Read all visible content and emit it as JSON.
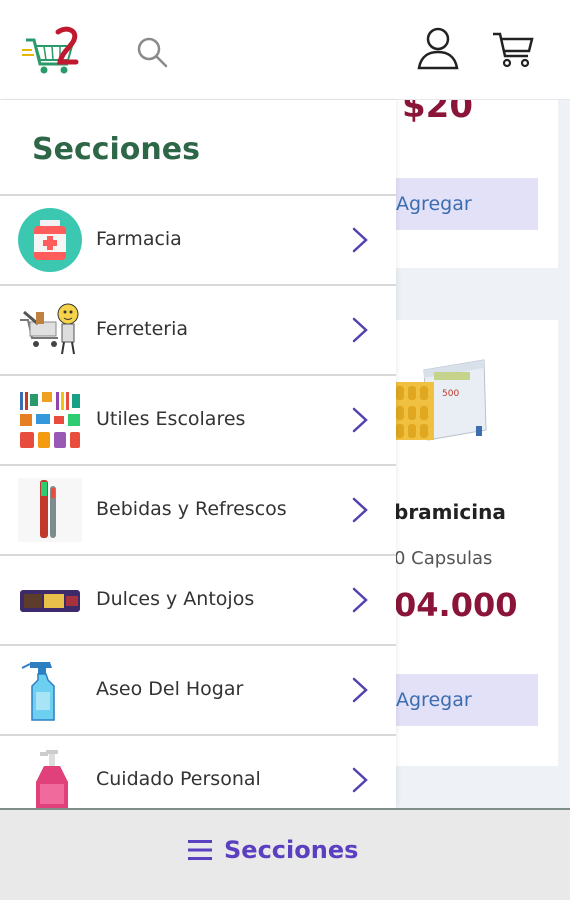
{
  "header": {
    "icons": [
      "logo",
      "search-icon",
      "user-icon",
      "cart-icon"
    ]
  },
  "background_cards": {
    "card1": {
      "price": "$20",
      "button": "Agregar"
    },
    "card2": {
      "name": "bramicina",
      "desc": "0 Capsulas",
      "price": "04.000",
      "button": "Agregar"
    }
  },
  "drawer": {
    "title": "Secciones",
    "items": [
      {
        "label": "Farmacia",
        "icon": "pharmacy-icon"
      },
      {
        "label": "Ferreteria",
        "icon": "hardware-icon"
      },
      {
        "label": "Utiles Escolares",
        "icon": "school-supplies-icon"
      },
      {
        "label": "Bebidas y Refrescos",
        "icon": "beverages-icon"
      },
      {
        "label": "Dulces y Antojos",
        "icon": "sweets-icon"
      },
      {
        "label": "Aseo Del Hogar",
        "icon": "cleaning-icon"
      },
      {
        "label": "Cuidado Personal",
        "icon": "personal-care-icon"
      }
    ]
  },
  "bottom_bar": {
    "label": "Secciones"
  },
  "colors": {
    "title_green": "#2e6747",
    "price_maroon": "#8a1538",
    "bottom_purple": "#5a3fc0",
    "button_bg": "#e3e1f7"
  }
}
